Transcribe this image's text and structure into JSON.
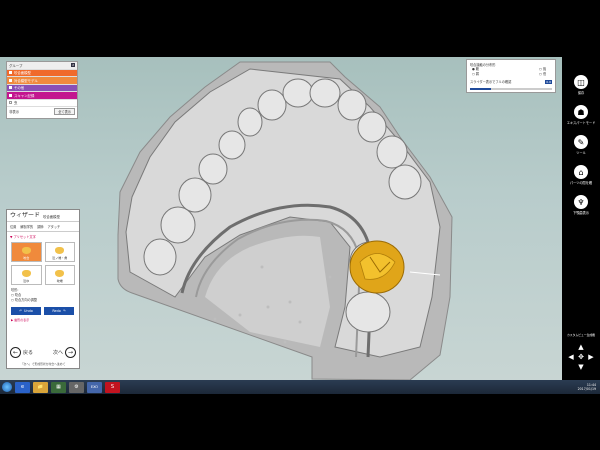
{
  "group_panel": {
    "header": "グループ",
    "count": "2",
    "rows": [
      {
        "label": "咬合面模型",
        "color": "#f06a2b"
      },
      {
        "label": "対合模型モデル",
        "color": "#f08a3c"
      },
      {
        "label": "その他",
        "color": "#8a4fb5"
      },
      {
        "label": "スキャン記録",
        "color": "#c3168f"
      },
      {
        "label": "虫",
        "color": "#ffffff"
      }
    ],
    "hide_label": "非表示",
    "apply_label": "全て表示"
  },
  "bite_panel": {
    "title": "咬合接触の分布形",
    "options": [
      {
        "left": "範",
        "right": "強"
      },
      {
        "left": "弱",
        "right": "低"
      }
    ],
    "slider_label": "スライダー表示でフルの確認",
    "slider_value": "0.6",
    "slider_fraction": 0.25
  },
  "wizard": {
    "title": "ウィザード",
    "subtitle": "咬合面模型",
    "tabs": [
      "位置",
      "解剖学的",
      "調節",
      "アタッチ"
    ],
    "section": "プリセット文字",
    "cells": [
      {
        "label": "咬合",
        "selected": true
      },
      {
        "label": "近ノ端・角",
        "selected": false
      },
      {
        "label": "近ゆ",
        "selected": false
      },
      {
        "label": "咬端",
        "selected": false
      }
    ],
    "opts": [
      "咬形:",
      "○ 咬合",
      "○ 咬合方向の調整",
      "調整範囲:",
      "○ 約指針",
      "○ 最大適用"
    ],
    "undo": "Undo",
    "redo": "Redo",
    "note": "歯形の表示",
    "back": "戻る",
    "next": "次へ",
    "footer": "「次へ」で形成形状を咬合へ進めて"
  },
  "right_bar": [
    {
      "label": "保存",
      "icon": "save-icon"
    },
    {
      "label": "エキスパートモード",
      "icon": "expert-icon"
    },
    {
      "label": "ツール",
      "icon": "tools-icon"
    },
    {
      "label": "パーツの間を確",
      "icon": "parts-icon"
    },
    {
      "label": "下顎歯表示",
      "icon": "tooth-icon"
    }
  ],
  "view_label": "カスタムビュー生成機",
  "taskbar": {
    "apps": [
      "e",
      "📁",
      "▦",
      "⚙",
      "EXO",
      "S"
    ],
    "time": "11:44",
    "date": "2017/01/19"
  }
}
